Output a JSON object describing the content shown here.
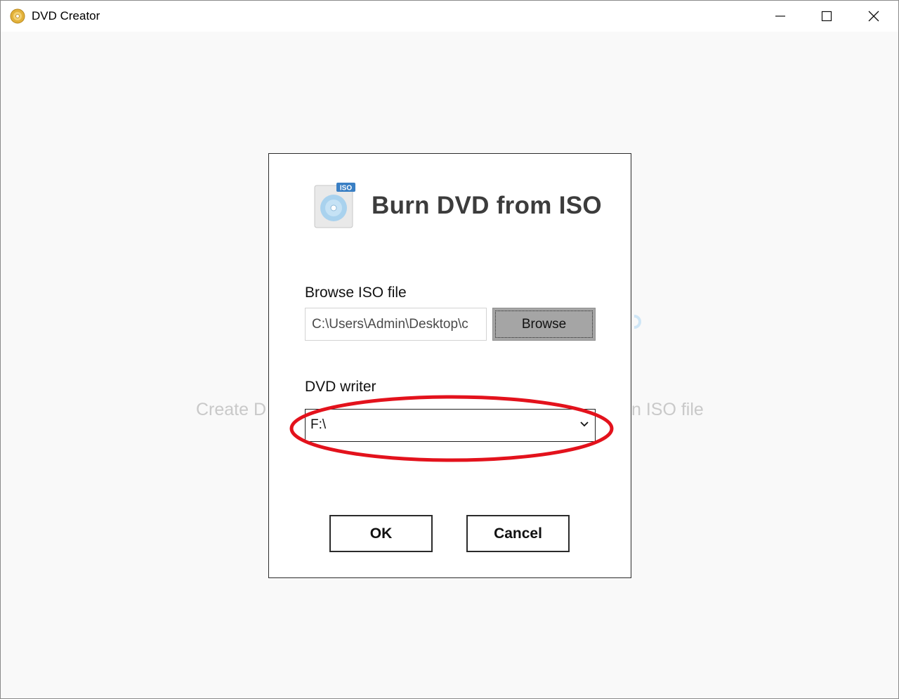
{
  "window": {
    "title": "DVD Creator",
    "controls": {
      "minimize": "minimize-icon",
      "maximize": "maximize-icon",
      "close": "close-icon"
    }
  },
  "background": {
    "left_text": "Create D",
    "right_text": "n ISO file"
  },
  "dialog": {
    "title": "Burn DVD from ISO",
    "icon_badge": "ISO",
    "iso_label": "Browse ISO file",
    "iso_path": "C:\\Users\\Admin\\Desktop\\c",
    "browse_label": "Browse",
    "writer_label": "DVD writer",
    "writer_value": "F:\\",
    "ok_label": "OK",
    "cancel_label": "Cancel"
  },
  "colors": {
    "highlight_ellipse": "#e3121c",
    "browse_bg": "#a5a5a5",
    "window_bg": "#f9f9f9"
  }
}
